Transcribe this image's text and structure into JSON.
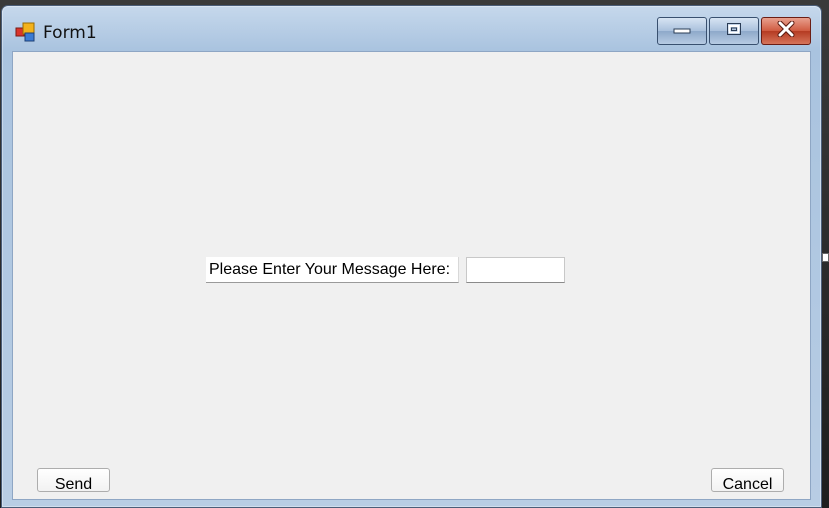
{
  "window": {
    "title": "Form1",
    "controls": {
      "minimize_icon": "minimize-icon",
      "maximize_icon": "maximize-icon",
      "close_icon": "close-icon"
    }
  },
  "form": {
    "message_label": "Please Enter Your Message Here:",
    "message_input_value": "",
    "send_label": "Send",
    "cancel_label": "Cancel"
  },
  "colors": {
    "client_background": "#f0f0f0",
    "titlebar": "#a9c3df",
    "close_button": "#c9452b"
  }
}
